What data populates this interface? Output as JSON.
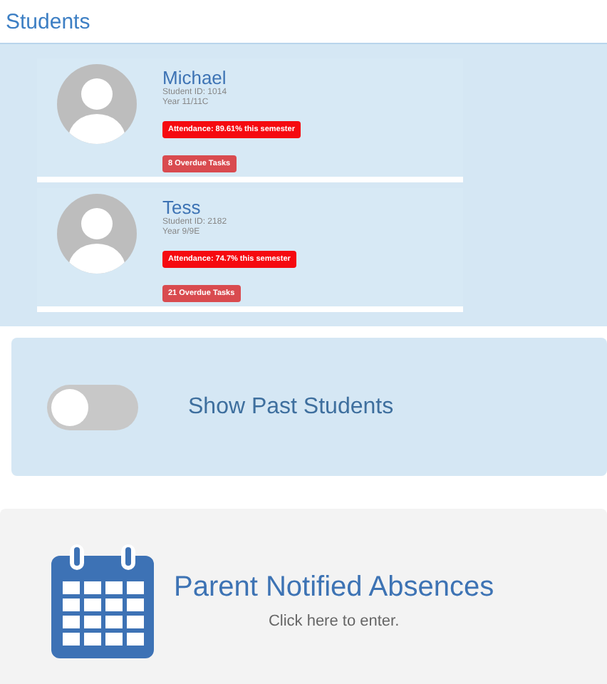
{
  "title": "Students",
  "students": [
    {
      "name": "Michael",
      "student_id": "Student ID: 1014",
      "year": "Year 11/11C",
      "attendance": "Attendance: 89.61% this semester",
      "overdue": "8 Overdue Tasks"
    },
    {
      "name": "Tess",
      "student_id": "Student ID: 2182",
      "year": "Year 9/9E",
      "attendance": "Attendance: 74.7% this semester",
      "overdue": "21 Overdue Tasks"
    }
  ],
  "past_students_toggle": {
    "label": "Show Past Students",
    "on": false
  },
  "absences": {
    "title": "Parent Notified Absences",
    "subtitle": "Click here to enter."
  }
}
